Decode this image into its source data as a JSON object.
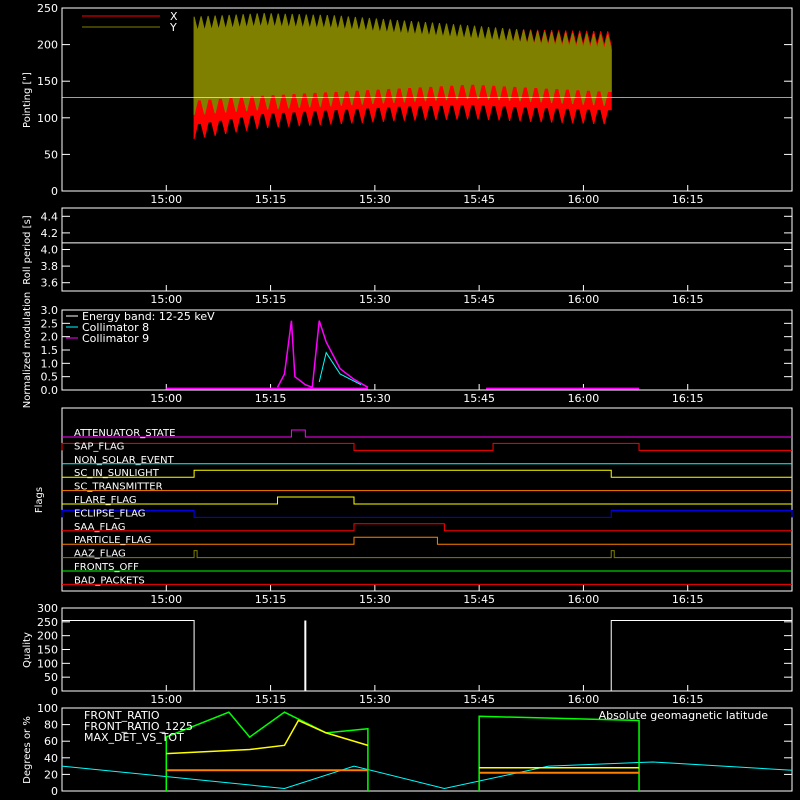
{
  "time_ticks": [
    "15:00",
    "15:15",
    "15:30",
    "15:45",
    "16:00",
    "16:15"
  ],
  "chart_data": [
    {
      "id": "pointing",
      "type": "area",
      "ylabel": "Pointing [\"]",
      "ylim": [
        0,
        250
      ],
      "yticks": [
        "0",
        "50",
        "100",
        "150",
        "200",
        "250"
      ],
      "legend": [
        {
          "name": "X",
          "color": "#ff0000"
        },
        {
          "name": "Y",
          "color": "#808000"
        }
      ],
      "span_minutes": [
        15.05,
        16.05
      ],
      "series": [
        {
          "name": "X",
          "color": "#ff0000",
          "upper": [
            225,
            230,
            225,
            220,
            215,
            212,
            210
          ],
          "lower": [
            85,
            100,
            105,
            110,
            112,
            108,
            105
          ]
        },
        {
          "name": "Y",
          "color": "#808000",
          "upper": [
            230,
            235,
            232,
            225,
            218,
            210,
            205
          ],
          "lower": [
            118,
            125,
            130,
            135,
            140,
            135,
            130
          ]
        }
      ],
      "reference_line": 128
    },
    {
      "id": "roll",
      "type": "line",
      "ylabel": "Roll period [s]",
      "ylim": [
        3.5,
        4.5
      ],
      "yticks": [
        "3.6",
        "3.8",
        "4.0",
        "4.2",
        "4.4"
      ],
      "value": 4.08
    },
    {
      "id": "modulation",
      "type": "line",
      "ylabel": "Normalized modulation",
      "ylim": [
        0,
        3
      ],
      "yticks": [
        "0.0",
        "0.5",
        "1.0",
        "1.5",
        "2.0",
        "2.5",
        "3.0"
      ],
      "legend": [
        {
          "name": "Energy band: 12-25 keV",
          "color": "#ffffff"
        },
        {
          "name": "Collimator 8",
          "color": "#00ffff"
        },
        {
          "name": "Collimator 9",
          "color": "#ff00ff"
        }
      ],
      "peaks": [
        {
          "t": "15:18",
          "value": 2.6
        },
        {
          "t": "15:22",
          "value": 2.6
        }
      ]
    },
    {
      "id": "flags",
      "type": "step",
      "ylabel": "Flags",
      "flags": [
        {
          "name": "ATTENUATOR_STATE",
          "color": "#ff00ff",
          "on": [
            [
              "15:18",
              "15:20"
            ]
          ]
        },
        {
          "name": "SAP_FLAG",
          "color": "#ff0000",
          "on": [
            [
              "14:45",
              "15:27"
            ],
            [
              "15:47",
              "16:08"
            ]
          ]
        },
        {
          "name": "NON_SOLAR_EVENT",
          "color": "#00ffff",
          "on": []
        },
        {
          "name": "SC_IN_SUNLIGHT",
          "color": "#ffff00",
          "on": [
            [
              "15:04",
              "16:04"
            ]
          ]
        },
        {
          "name": "SC_TRANSMITTER",
          "color": "#ff8000",
          "on": []
        },
        {
          "name": "FLARE_FLAG",
          "color": "#ffff00",
          "on": [
            [
              "15:16",
              "15:27"
            ]
          ]
        },
        {
          "name": "ECLIPSE_FLAG",
          "color": "#0000ff",
          "on": [
            [
              "14:45",
              "15:04"
            ],
            [
              "16:04",
              "16:30"
            ]
          ]
        },
        {
          "name": "SAA_FLAG",
          "color": "#ff0000",
          "on": [
            [
              "15:27",
              "15:40"
            ]
          ]
        },
        {
          "name": "PARTICLE_FLAG",
          "color": "#ff8000",
          "on": [
            [
              "15:27",
              "15:39"
            ]
          ]
        },
        {
          "name": "AAZ_FLAG",
          "color": "#808000",
          "on": [
            [
              "15:04",
              "15:04"
            ],
            [
              "16:04",
              "16:04"
            ]
          ]
        },
        {
          "name": "FRONTS_OFF",
          "color": "#00ff00",
          "on": []
        },
        {
          "name": "BAD_PACKETS",
          "color": "#ff0000",
          "on": []
        }
      ]
    },
    {
      "id": "quality",
      "type": "line",
      "ylabel": "Quality",
      "ylim": [
        0,
        300
      ],
      "yticks": [
        "0",
        "50",
        "100",
        "150",
        "200",
        "250",
        "300"
      ],
      "high_before": "15:04",
      "high_after": "16:04",
      "high_value": 255,
      "spike": {
        "t": "15:20",
        "value": 255
      }
    },
    {
      "id": "ratios",
      "type": "line",
      "ylabel": "Degrees or %",
      "ylim": [
        0,
        100
      ],
      "yticks": [
        "0",
        "20",
        "40",
        "60",
        "80",
        "100"
      ],
      "legend": [
        {
          "name": "FRONT_RATIO",
          "color": "#ffff00"
        },
        {
          "name": "FRONT_RATIO_1225",
          "color": "#00ff00"
        },
        {
          "name": "MAX_DET_VS_TOT",
          "color": "#ff8000"
        }
      ],
      "right_label": {
        "text": "Absolute geomagnetic latitude",
        "color": "#00ffff"
      }
    }
  ]
}
